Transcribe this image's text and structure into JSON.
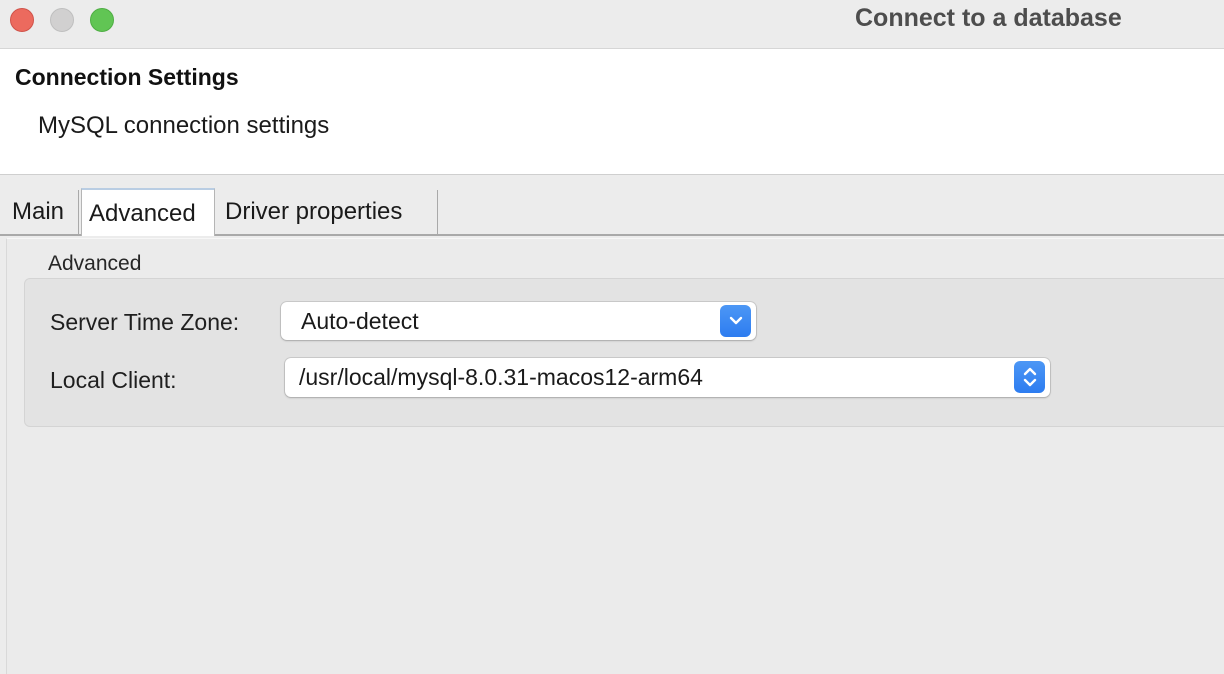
{
  "window": {
    "title": "Connect to a database"
  },
  "header": {
    "title": "Connection Settings",
    "subtitle": "MySQL connection settings"
  },
  "tabs": [
    {
      "label": "Main",
      "active": false
    },
    {
      "label": "Advanced",
      "active": true
    },
    {
      "label": "Driver properties",
      "active": false
    }
  ],
  "advanced": {
    "group_label": "Advanced",
    "server_time_zone": {
      "label": "Server Time Zone:",
      "value": "Auto-detect"
    },
    "local_client": {
      "label": "Local Client:",
      "value": "/usr/local/mysql-8.0.31-macos12-arm64"
    }
  },
  "colors": {
    "accent": "#2d7cf0",
    "close": "#ec6a5e",
    "minimize": "#d1d0d0",
    "zoom": "#61c554"
  },
  "icons": {
    "time_zone_dropdown": "chevron-down-icon",
    "local_client_dropdown": "up-down-chevron-icon"
  }
}
